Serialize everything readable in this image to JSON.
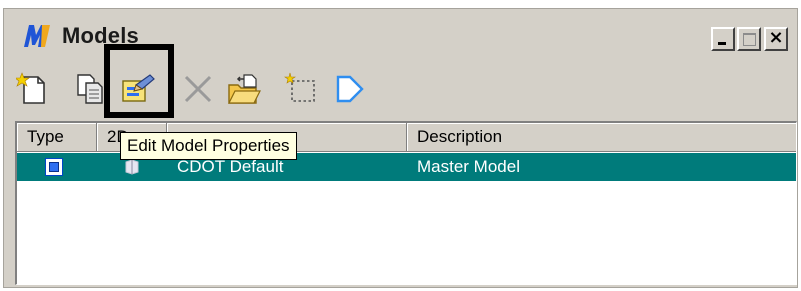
{
  "window": {
    "title": "Models",
    "controls": {
      "minimize": "_",
      "close": "×"
    }
  },
  "toolbar": {
    "tools": [
      {
        "name": "create-model-icon"
      },
      {
        "name": "copy-model-icon"
      },
      {
        "name": "edit-model-properties-icon"
      },
      {
        "name": "delete-model-icon"
      },
      {
        "name": "import-model-icon"
      },
      {
        "name": "select-dependent-icon"
      },
      {
        "name": "filter-icon"
      }
    ]
  },
  "list": {
    "columns": [
      "Type",
      "2D",
      "",
      "Description"
    ],
    "rows": [
      {
        "name": "CDOT Default",
        "description": "Master Model",
        "selected": true
      }
    ]
  },
  "tooltip": {
    "text": "Edit Model Properties"
  },
  "colors": {
    "selection": "#007b7b",
    "tooltip_bg": "#ffffe1",
    "chrome": "#d4d0c8"
  }
}
